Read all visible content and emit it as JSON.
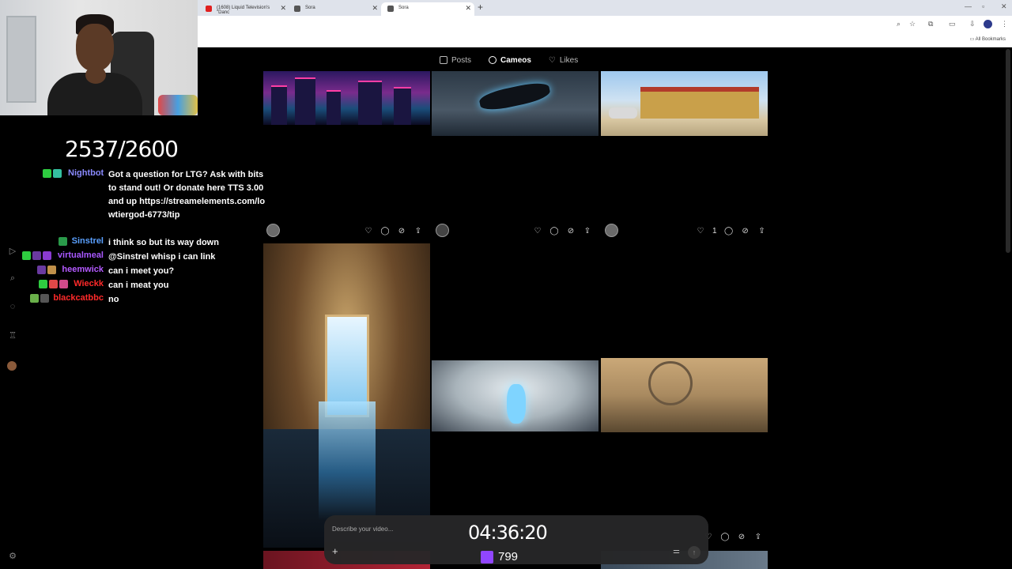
{
  "browser": {
    "tabs": [
      {
        "label": "(1608) Liquid Television's \"Danc",
        "active": false
      },
      {
        "label": "Sora",
        "active": false
      },
      {
        "label": "Sora",
        "active": true
      }
    ],
    "all_bookmarks_label": "All Bookmarks"
  },
  "overlay": {
    "counter": "2537/2600",
    "timer": "04:36:20",
    "sub_count": "799"
  },
  "chat": {
    "messages": [
      {
        "user": "Nightbot",
        "color": "#8a8aff",
        "text": "Got a question for LTG? Ask with bits to stand out! Or donate here TTS 3.00 and up https://streamelements.com/lowtiergod-6773/tip"
      },
      {
        "user": "Sinstrel",
        "color": "#5aa0ff",
        "text": "i think so but its way down"
      },
      {
        "user": "virtualmeal",
        "color": "#a858ff",
        "text": "@Sinstrel whisp i can link"
      },
      {
        "user": "heemwick",
        "color": "#b45aff",
        "text": "can i meet you?"
      },
      {
        "user": "Wieckk",
        "color": "#ff2a2a",
        "text": "can i meat you"
      },
      {
        "user": "blackcatbbc",
        "color": "#ff2a2a",
        "text": "no"
      }
    ]
  },
  "sora": {
    "nav": [
      "Posts",
      "Cameos",
      "Likes"
    ],
    "active_nav": "Cameos",
    "card_like_count": "1",
    "composer_placeholder": "Describe your video..."
  },
  "icons": [
    "heart-icon",
    "comment-icon",
    "remix-icon",
    "share-icon",
    "plus-icon",
    "settings-sliders-icon",
    "send-icon"
  ]
}
